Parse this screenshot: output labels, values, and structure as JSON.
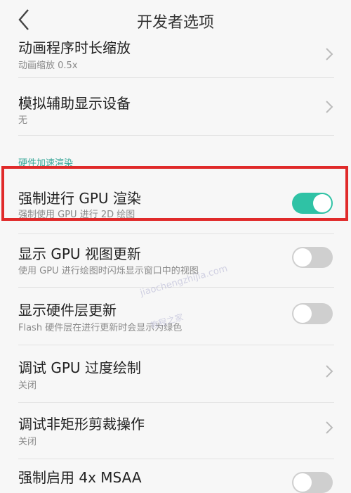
{
  "header": {
    "title": "开发者选项"
  },
  "items": [
    {
      "title": "动画程序时长缩放",
      "subtitle": "动画缩放 0.5x"
    },
    {
      "title": "模拟辅助显示设备",
      "subtitle": "无"
    }
  ],
  "section": {
    "label": "硬件加速渲染"
  },
  "toggles": [
    {
      "title": "强制进行 GPU 渲染",
      "subtitle": "强制使用 GPU 进行 2D 绘图",
      "state": "on"
    },
    {
      "title": "显示 GPU 视图更新",
      "subtitle": "使用 GPU 进行绘图时闪烁显示窗口中的视图",
      "state": "off"
    },
    {
      "title": "显示硬件层更新",
      "subtitle": "Flash 硬件层在进行更新时会显示为绿色",
      "state": "off"
    }
  ],
  "items2": [
    {
      "title": "调试 GPU 过度绘制",
      "subtitle": "关闭"
    },
    {
      "title": "调试非矩形剪裁操作",
      "subtitle": "关闭"
    }
  ],
  "last": {
    "title": "强制启用 4x MSAA",
    "state": "off"
  },
  "watermark": {
    "line1": "jiaochengzhijia.com",
    "line2": "教程之家"
  },
  "colors": {
    "accent": "#2fc2a5",
    "highlight": "#e02a2a",
    "section": "#3aa89a"
  }
}
